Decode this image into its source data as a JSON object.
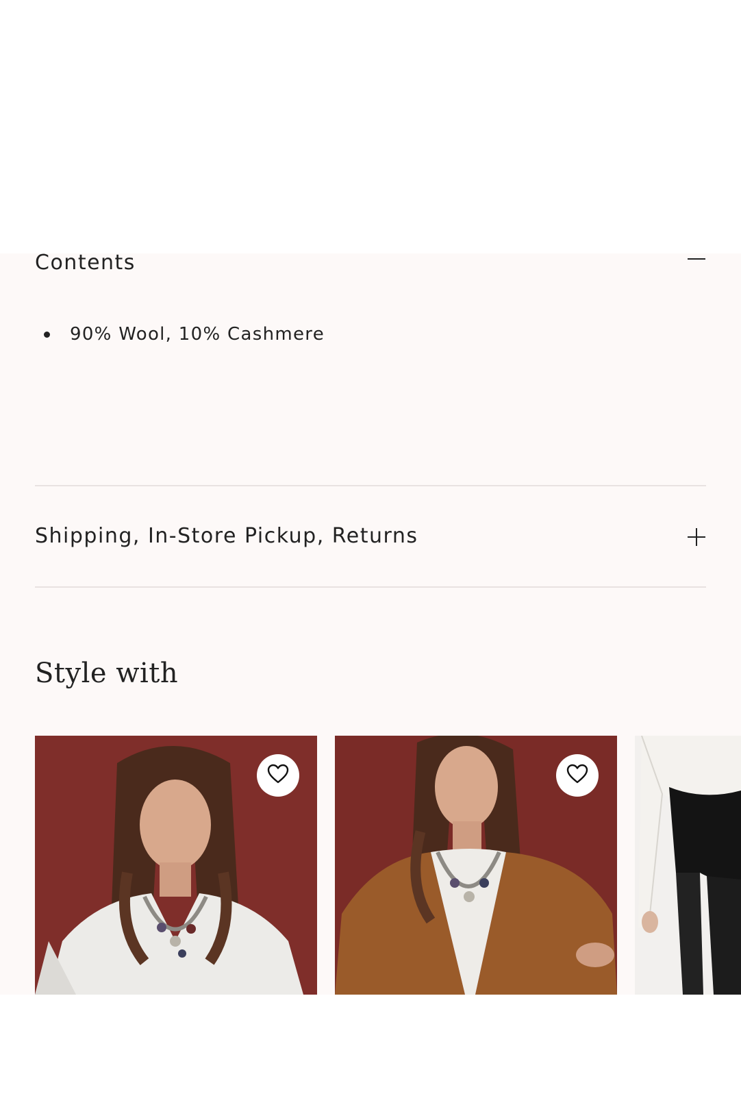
{
  "contents": {
    "title": "Contents",
    "toggle_icon": "minus-icon",
    "items": [
      "90% Wool, 10% Cashmere"
    ]
  },
  "shipping": {
    "title": "Shipping, In-Store Pickup, Returns",
    "toggle_icon": "plus-icon"
  },
  "style_with": {
    "heading": "Style with",
    "products": [
      {
        "image": "model in white waffle-knit henley with layered charm necklaces against red backdrop",
        "wishlist_icon": "heart-icon"
      },
      {
        "image": "model in brown cardigan over white henley with layered charm necklaces against red backdrop",
        "wishlist_icon": "heart-icon"
      },
      {
        "image": "black shorts and sheer black tights with white shirt, partially visible",
        "wishlist_icon": "none"
      }
    ]
  },
  "colors": {
    "panel_background": "#fdf9f8",
    "divider": "#e8e2e1",
    "text": "#222222",
    "backdrop_red": "#7a2b27",
    "cardigan_brown": "#9a5b2a"
  }
}
